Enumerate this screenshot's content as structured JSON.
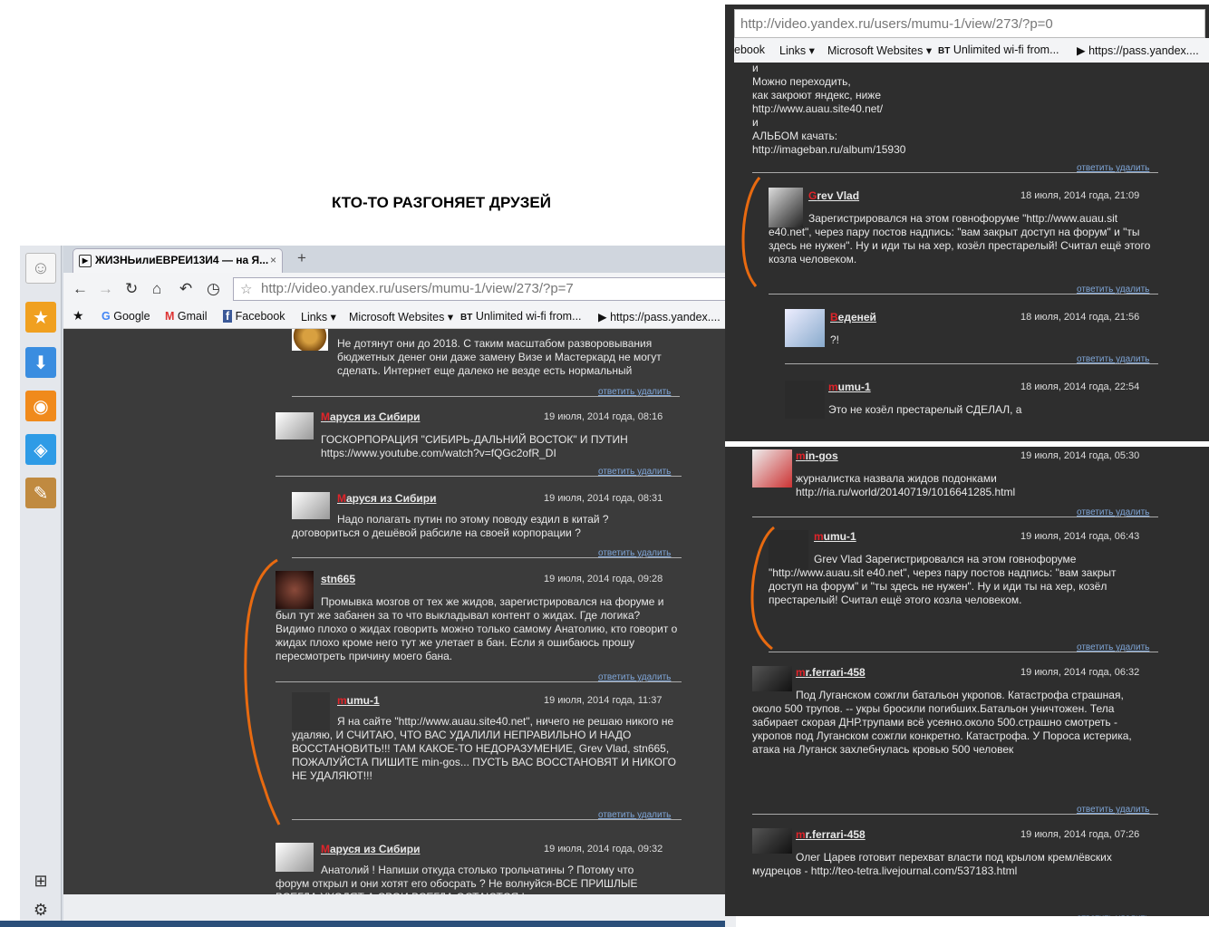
{
  "caption": "КТО-ТО РАЗГОНЯЕТ ДРУЗЕЙ",
  "left": {
    "tab_title": "ЖИЗНЬилиЕВРЕИ13И4 — на Я...",
    "tab_close": "×",
    "new_tab": "+",
    "url": "http://video.yandex.ru/users/mumu-1/view/273/?p=7",
    "bookmarks": [
      "Google",
      "Gmail",
      "Facebook",
      "Links ▾",
      "Microsoft Websites ▾",
      "Unlimited wi-fi from...",
      "https://pass.yandex...."
    ],
    "comments": [
      {
        "name": "",
        "text": "Не дотянут они до 2018. С таким масштабом разворовывания бюджетных денег они даже замену Визе и Мастеркард не могут сделать. Интернет еще далеко не везде есть нормальный",
        "date": ""
      },
      {
        "name_first": "М",
        "name_rest": "аруся из Сибири",
        "date": "19 июля, 2014 года, 08:16",
        "text": "ГОСКОРПОРАЦИЯ \"СИБИРЬ-ДАЛЬНИЙ ВОСТОК\" И ПУТИН https://www.youtube.com/watch?v=fQGc2ofR_DI"
      },
      {
        "name_first": "М",
        "name_rest": "аруся из Сибири",
        "date": "19 июля, 2014 года, 08:31",
        "text": "Надо полагать путин по этому поводу ездил в китай ? договориться о дешёвой рабсиле на своей корпорации ?"
      },
      {
        "name_first": "",
        "name_rest": "stn665",
        "date": "19 июля, 2014 года, 09:28",
        "text": "Промывка мозгов от тех же жидов, зарегистрировался на форуме и был тут же забанен за то что выкладывал контент о жидах. Где логика? Видимо плохо о жидах говорить можно только самому Анатолию, кто говорит о жидах плохо кроме него тут же улетает в бан. Если я ошибаюсь прошу пересмотреть причину моего бана."
      },
      {
        "name_first": "m",
        "name_rest": "umu-1",
        "date": "19 июля, 2014 года, 11:37",
        "text": "Я на сайте \"http://www.auau.site40.net\", ничего не решаю никого не удаляю, И СЧИТАЮ, ЧТО ВАС УДАЛИЛИ НЕПРАВИЛЬНО И НАДО ВОССТАНОВИТЬ!!! ТАМ КАКОЕ-ТО НЕДОРАЗУМЕНИЕ, Grev Vlad, stn665, ПОЖАЛУЙСТА ПИШИТЕ min-gos... ПУСТЬ ВАС ВОССТАНОВЯТ И НИКОГО НЕ УДАЛЯЮТ!!!"
      },
      {
        "name_first": "М",
        "name_rest": "аруся из Сибири",
        "date": "19 июля, 2014 года, 09:32",
        "text": "Анатолий ! Напиши откуда столько трольчатины ? Потому что форум открыл и они хотят его обосрать ? Не волнуйся-ВСЕ ПРИШЛЫЕ ВСЕГДА УХОДЯТ А СВОИ ВСЕГДА ОСТАЮТСЯ !"
      }
    ],
    "reply_link": "ответить  удалить"
  },
  "right": {
    "url": "http://video.yandex.ru/users/mumu-1/view/273/?p=0",
    "bookmarks": [
      "ebook",
      "Links ▾",
      "Microsoft Websites ▾",
      "Unlimited wi-fi from...",
      "https://pass.yandex...."
    ],
    "top_text": [
      "и",
      "Можно переходить,",
      "как закроют яндекс, ниже",
      "http://www.auau.site40.net/",
      "и",
      "АЛЬБОМ качать:",
      "http://imageban.ru/album/15930"
    ],
    "comments": [
      {
        "name_first": "G",
        "name_rest": "rev Vlad",
        "date": "18 июля, 2014 года, 21:09",
        "text": "Зарегистрировался на этом говнофоруме \"http://www.auau.sit e40.net\", через пару постов надпись: \"вам закрыт доступ на форум\" и \"ты здесь не нужен\". Ну и иди ты на хер, козёл престарелый! Считал ещё этого козла человеком."
      },
      {
        "name_first": "В",
        "name_rest": "еденей",
        "date": "18 июля, 2014 года, 21:56",
        "text": "?!"
      },
      {
        "name_first": "m",
        "name_rest": "umu-1",
        "date": "18 июля, 2014 года, 22:54",
        "text": "Это не козёл престарелый СДЕЛАЛ, а"
      },
      {
        "name_first": "m",
        "name_rest": "in-gos",
        "date": "19 июля, 2014 года, 05:30",
        "text": "журналистка назвала жидов подонками http://ria.ru/world/20140719/1016641285.html"
      },
      {
        "name_first": "m",
        "name_rest": "umu-1",
        "date": "19 июля, 2014 года, 06:43",
        "text": "Grev Vlad Зарегистрировался на этом говнофоруме \"http://www.auau.sit e40.net\", через пару постов надпись: \"вам закрыт доступ на форум\" и \"ты здесь не нужен\". Ну и иди ты на хер, козёл престарелый! Считал ещё этого козла человеком."
      },
      {
        "name_first": "m",
        "name_rest": "r.ferrari-458",
        "date": "19 июля, 2014 года, 06:32",
        "text": "Под Луганском сожгли батальон укропов. Катастрофа страшная, около 500 трупов. -- укры бросили погибших.Батальон уничтожен. Тела забирает скорая ДНР.трупами всё усеяно.около 500.страшно смотреть - укропов под Луганском сожгли конкретно. Катастрофа. У Пороса истерика, атака на Луганск захлебнулась кровью 500 человек"
      },
      {
        "name_first": "m",
        "name_rest": "r.ferrari-458",
        "date": "19 июля, 2014 года, 07:26",
        "text": "Олег Царев готовит перехват власти под крылом кремлёвских мудрецов - http://teo-tetra.livejournal.com/537183.html"
      }
    ],
    "reply_link": "ответить  удалить"
  }
}
